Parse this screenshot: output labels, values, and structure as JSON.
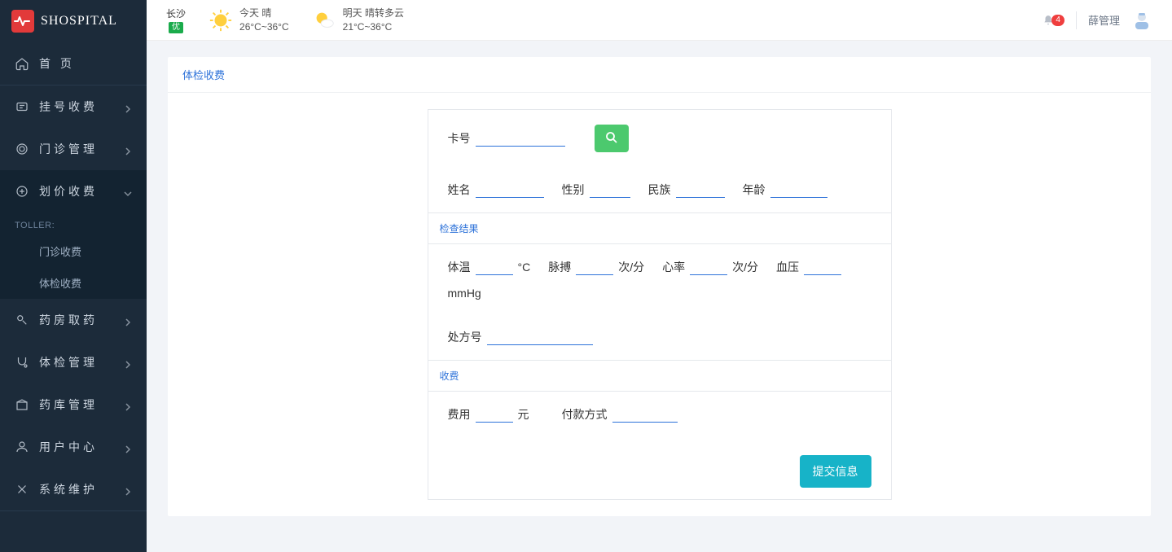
{
  "brand": "SHOSPITAL",
  "sidebar": {
    "home": "首 页",
    "items": [
      {
        "label": "挂号收费"
      },
      {
        "label": "门诊管理"
      },
      {
        "label": "划价收费"
      }
    ],
    "sub_header": "TOLLER:",
    "sub_items": [
      {
        "label": "门诊收费"
      },
      {
        "label": "体检收费"
      }
    ],
    "items2": [
      {
        "label": "药房取药"
      },
      {
        "label": "体检管理"
      },
      {
        "label": "药库管理"
      },
      {
        "label": "用户中心"
      },
      {
        "label": "系统维护"
      }
    ]
  },
  "topbar": {
    "city": "长沙",
    "city_badge": "优",
    "today_label": "今天  晴",
    "today_temp": "26°C~36°C",
    "tomorrow_label": "明天  晴转多云",
    "tomorrow_temp": "21°C~36°C",
    "notif_count": "4",
    "user": "薛管理"
  },
  "panel": {
    "title": "体检收费"
  },
  "form": {
    "card_no_label": "卡号",
    "name_label": "姓名",
    "gender_label": "性别",
    "nation_label": "民族",
    "age_label": "年龄",
    "section_exam": "检查结果",
    "temp_label": "体温",
    "temp_unit": "°C",
    "pulse_label": "脉搏",
    "per_min": "次/分",
    "hr_label": "心率",
    "bp_label": "血压",
    "bp_unit": "mmHg",
    "rx_label": "处方号",
    "section_fee": "收费",
    "fee_label": "费用",
    "fee_unit": "元",
    "pay_method_label": "付款方式",
    "submit": "提交信息"
  }
}
